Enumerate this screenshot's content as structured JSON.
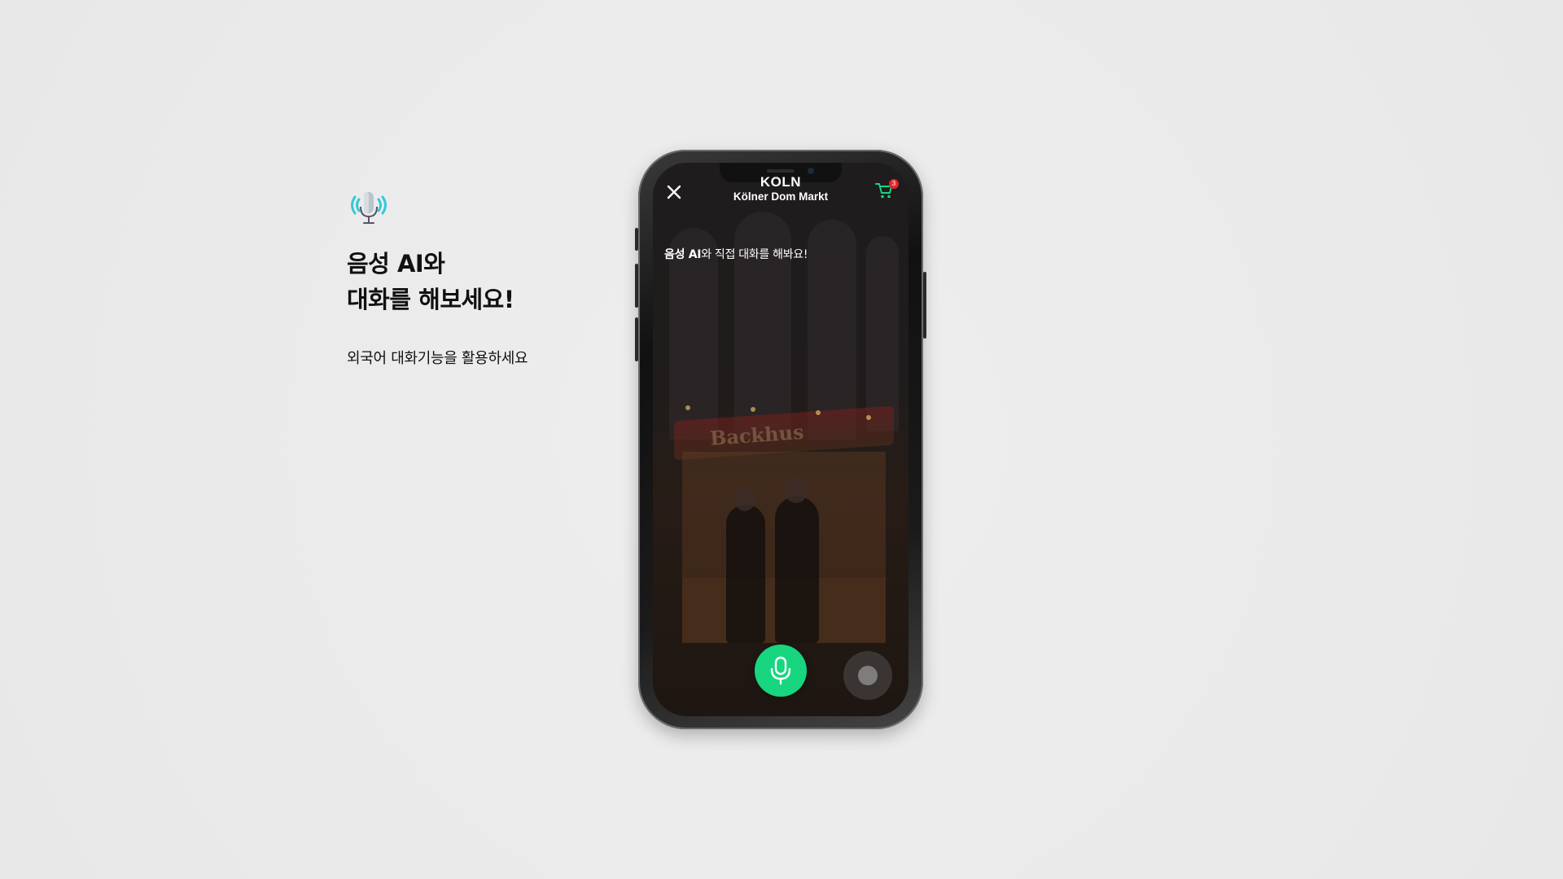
{
  "promo": {
    "icon": "voice-mic-icon",
    "headline_line1": "음성 AI와",
    "headline_line2": "대화를 해보세요!",
    "subtext": "외국어 대화기능을 활용하세요"
  },
  "app": {
    "city": "KÖLN",
    "market": "Kölner Dom Markt",
    "cart_count": "3",
    "prompt_bold": "음성 AI",
    "prompt_rest": "와 직접 대화를 해봐요!",
    "booth_sign": "Backhus"
  },
  "colors": {
    "accent_green": "#17d67f",
    "badge_red": "#e2262a",
    "icon_teal": "#33c9d8"
  }
}
